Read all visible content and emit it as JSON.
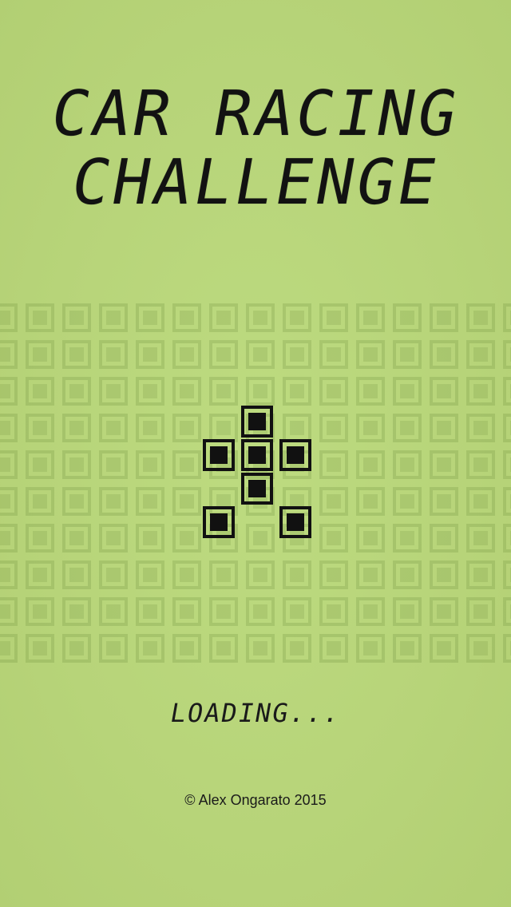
{
  "title": {
    "line1": "CAR RACING",
    "line2": "CHALLENGE"
  },
  "loading_text": "LOADING...",
  "copyright": "© Alex Ongarato 2015",
  "colors": {
    "background": "#b9d67b",
    "pixel_on": "#111111",
    "pixel_off": "#9fbd63"
  },
  "car_sprite": {
    "icon": "car-sprite-icon",
    "cells": [
      [
        0,
        1,
        0
      ],
      [
        1,
        1,
        1
      ],
      [
        0,
        1,
        0
      ],
      [
        1,
        0,
        1
      ]
    ]
  }
}
